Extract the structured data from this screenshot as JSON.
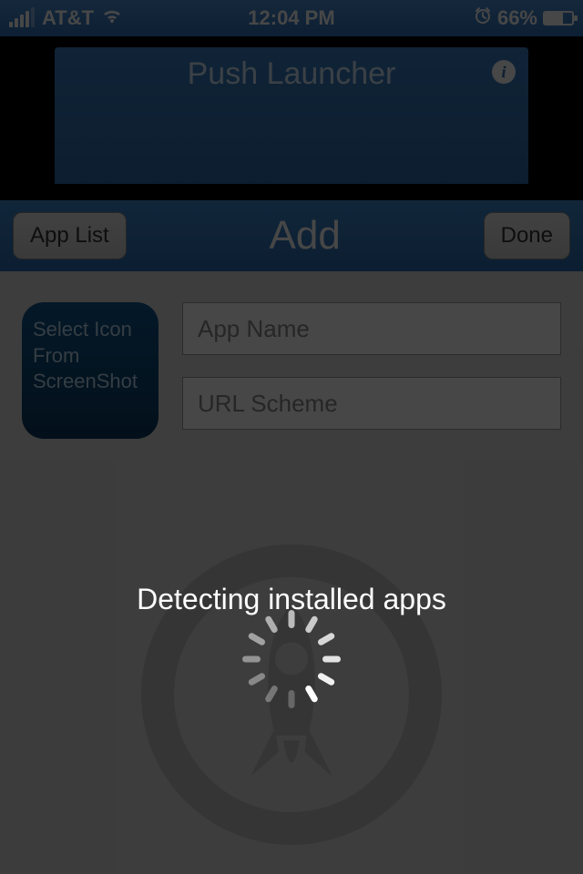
{
  "statusbar": {
    "carrier": "AT&T",
    "time": "12:04 PM",
    "battery_percent": "66%"
  },
  "banner": {
    "title": "Push Launcher"
  },
  "navbar": {
    "left_button": "App List",
    "title": "Add",
    "right_button": "Done"
  },
  "form": {
    "icon_tile_label": "Select Icon From ScreenShot",
    "field1_placeholder": "App Name",
    "field2_placeholder": "URL Scheme"
  },
  "overlay": {
    "message": "Detecting installed apps"
  }
}
